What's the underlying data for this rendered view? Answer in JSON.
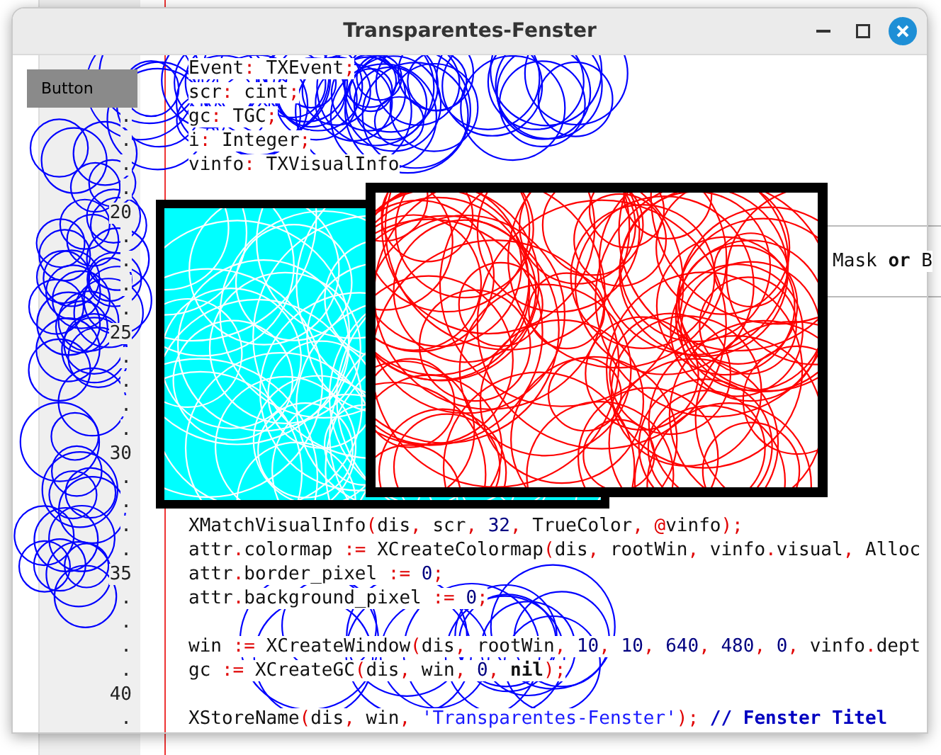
{
  "window": {
    "title": "Transparentes-Fenster",
    "button": "Button"
  },
  "editor": {
    "lines": [
      {
        "text": "Event: TXEvent;",
        "kind": "code"
      },
      {
        "text": "scr: cint;",
        "kind": "code"
      },
      {
        "number": ".",
        "text": "gc: TGC;",
        "kind": "code"
      },
      {
        "number": ".",
        "text": "i: Integer;",
        "kind": "code"
      },
      {
        "number": ".",
        "text": "vinfo: TXVisualInfo",
        "kind": "code"
      },
      {
        "number": ".",
        "kind": "code"
      },
      {
        "number": "20",
        "kind": "code"
      },
      {
        "number": ".",
        "kind": "region-top"
      },
      {
        "number": ".",
        "text": "Mask **or** B",
        "kind": "tail"
      },
      {
        "number": ".",
        "kind": "region-bottom"
      },
      {
        "number": ".",
        "kind": "code"
      },
      {
        "number": "25",
        "kind": "code"
      },
      {
        "number": ".",
        "kind": "code"
      },
      {
        "number": ".",
        "kind": "code"
      },
      {
        "number": ".",
        "kind": "code"
      },
      {
        "number": ".",
        "kind": "code"
      },
      {
        "number": "30",
        "kind": "code"
      },
      {
        "number": ".",
        "kind": "code"
      },
      {
        "number": ".",
        "kind": "code"
      },
      {
        "number": ".",
        "text": "XMatchVisualInfo(dis, scr, 32, TrueColor, @vinfo);",
        "kind": "code"
      },
      {
        "number": ".",
        "text": "attr.colormap := XCreateColormap(dis, rootWin, vinfo.visual, Alloc",
        "kind": "code"
      },
      {
        "number": "35",
        "text": "attr.border_pixel := 0;",
        "kind": "code"
      },
      {
        "number": ".",
        "text": "attr.background_pixel := 0;",
        "kind": "code"
      },
      {
        "number": ".",
        "kind": "code"
      },
      {
        "number": ".",
        "text": "win := XCreateWindow(dis, rootWin, 10, 10, 640, 480, 0, vinfo.dept",
        "kind": "code"
      },
      {
        "number": ".",
        "text": "gc := XCreateGC(dis, win, 0, **nil**);",
        "kind": "code"
      },
      {
        "number": "40",
        "kind": "code"
      },
      {
        "number": ".",
        "text": "XStoreName(dis, win, 'Transparentes-Fenster'); **// Fenster Titel**",
        "kind": "code"
      }
    ]
  }
}
